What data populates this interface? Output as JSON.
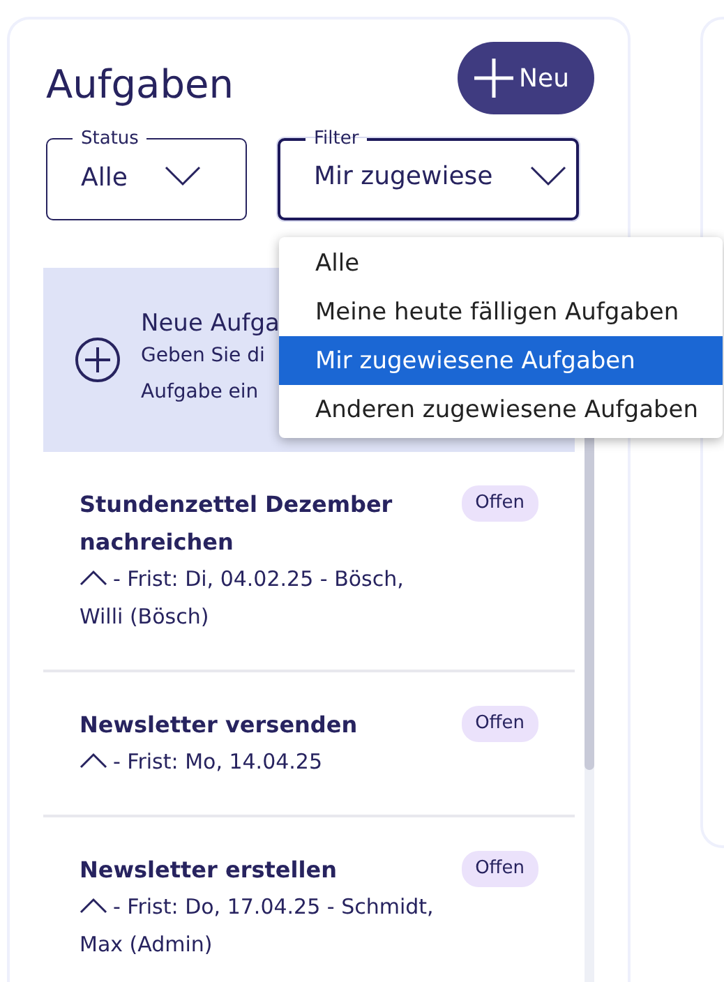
{
  "panel": {
    "title": "Aufgaben",
    "new_button": "Neu"
  },
  "filters": [
    {
      "label": "Status",
      "value": "Alle",
      "focused": false
    },
    {
      "label": "Filter",
      "value": "Mir zugewiese",
      "focused": true
    }
  ],
  "dropdown": {
    "options": [
      {
        "label": "Alle",
        "selected": false
      },
      {
        "label": "Meine heute fälligen Aufgaben",
        "selected": false
      },
      {
        "label": "Mir zugewiesene Aufgaben",
        "selected": true
      },
      {
        "label": "Anderen zugewiesene Aufgaben",
        "selected": false
      }
    ]
  },
  "new_task": {
    "title": "Neue Aufga",
    "lines": [
      "Geben Sie di",
      "Aufgabe ein"
    ]
  },
  "tasks": [
    {
      "title": "Stundenzettel Dezember nachreichen",
      "deadline": "- Frist: Di, 04.02.25 - Bösch, Willi (Bösch)",
      "status": "Offen"
    },
    {
      "title": "Newsletter versenden",
      "deadline": "- Frist: Mo, 14.04.25",
      "status": "Offen"
    },
    {
      "title": "Newsletter erstellen",
      "deadline": "- Frist: Do, 17.04.25 - Schmidt, Max (Admin)",
      "status": "Offen"
    }
  ]
}
